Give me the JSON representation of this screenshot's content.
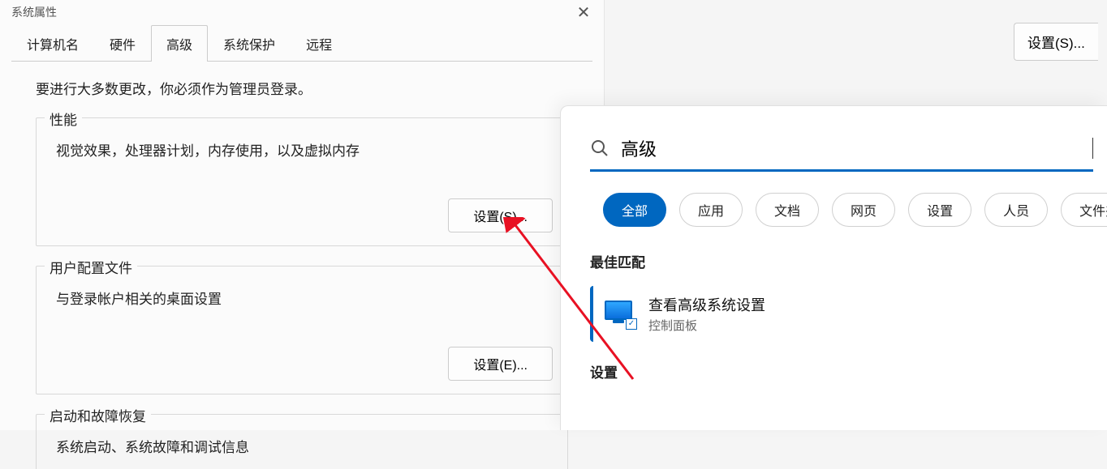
{
  "dialog": {
    "title": "系统属性",
    "tabs": {
      "computer_name": "计算机名",
      "hardware": "硬件",
      "advanced": "高级",
      "system_protection": "系统保护",
      "remote": "远程"
    },
    "note": "要进行大多数更改，你必须作为管理员登录。",
    "perf": {
      "legend": "性能",
      "desc": "视觉效果，处理器计划，内存使用，以及虚拟内存",
      "btn": "设置(S)..."
    },
    "profile": {
      "legend": "用户配置文件",
      "desc": "与登录帐户相关的桌面设置",
      "btn": "设置(E)..."
    },
    "startup": {
      "legend": "启动和故障恢复",
      "desc": "系统启动、系统故障和调试信息"
    }
  },
  "right_settings_btn": "设置(S)...",
  "search": {
    "query": "高级",
    "filters": {
      "all": "全部",
      "apps": "应用",
      "docs": "文档",
      "web": "网页",
      "settings": "设置",
      "people": "人员",
      "files": "文件夹"
    },
    "best_match": "最佳匹配",
    "result": {
      "title": "查看高级系统设置",
      "subtitle": "控制面板"
    },
    "settings_header": "设置"
  }
}
